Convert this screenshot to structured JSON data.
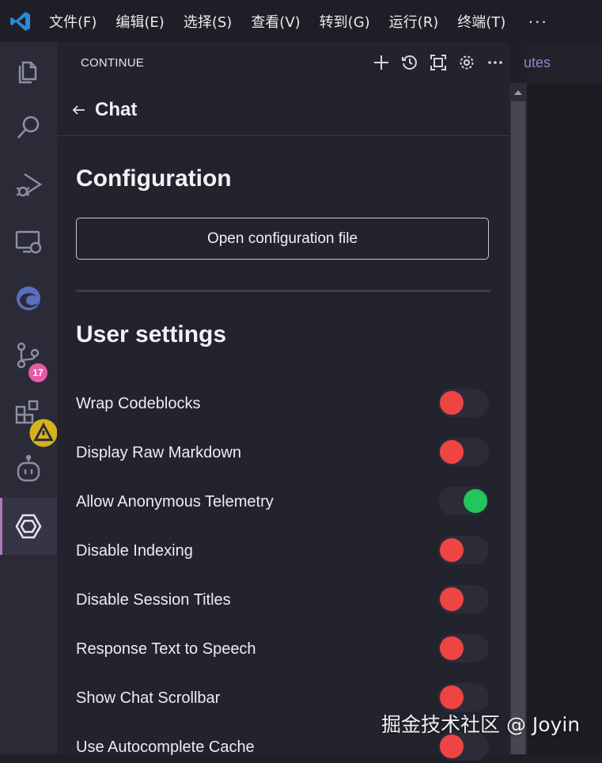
{
  "menubar": {
    "items": [
      "文件(F)",
      "编辑(E)",
      "选择(S)",
      "查看(V)",
      "转到(G)",
      "运行(R)",
      "终端(T)"
    ],
    "more": "···"
  },
  "activitybar": {
    "items": [
      {
        "icon": "explorer-icon"
      },
      {
        "icon": "search-icon"
      },
      {
        "icon": "run-debug-icon"
      },
      {
        "icon": "remote-explorer-icon"
      },
      {
        "icon": "edge-icon"
      },
      {
        "icon": "source-control-icon",
        "badge": "17"
      },
      {
        "icon": "extensions-icon",
        "badge_icon": "warning-icon"
      },
      {
        "icon": "copilot-icon"
      },
      {
        "icon": "continue-icon",
        "active": true
      }
    ]
  },
  "panel": {
    "title": "CONTINUE",
    "actions": [
      "plus-icon",
      "history-icon",
      "fullscreen-icon",
      "gear-icon",
      "more-icon"
    ]
  },
  "chat": {
    "back_icon": "arrow-left-icon",
    "title": "Chat"
  },
  "configuration": {
    "heading": "Configuration",
    "open_button": "Open configuration file"
  },
  "user_settings": {
    "heading": "User settings",
    "items": [
      {
        "label": "Wrap Codeblocks",
        "enabled": false
      },
      {
        "label": "Display Raw Markdown",
        "enabled": false
      },
      {
        "label": "Allow Anonymous Telemetry",
        "enabled": true
      },
      {
        "label": "Disable Indexing",
        "enabled": false
      },
      {
        "label": "Disable Session Titles",
        "enabled": false
      },
      {
        "label": "Response Text to Speech",
        "enabled": false
      },
      {
        "label": "Show Chat Scrollbar",
        "enabled": false
      },
      {
        "label": "Use Autocomplete Cache",
        "enabled": false
      }
    ]
  },
  "editor_peek": {
    "tab_text": "utes"
  },
  "watermark": "掘金技术社区 @ Joyin",
  "colors": {
    "toggle_off": "#ef4444",
    "toggle_on": "#22c55e",
    "accent": "#b07ab8",
    "badge": "#e65aa6"
  }
}
